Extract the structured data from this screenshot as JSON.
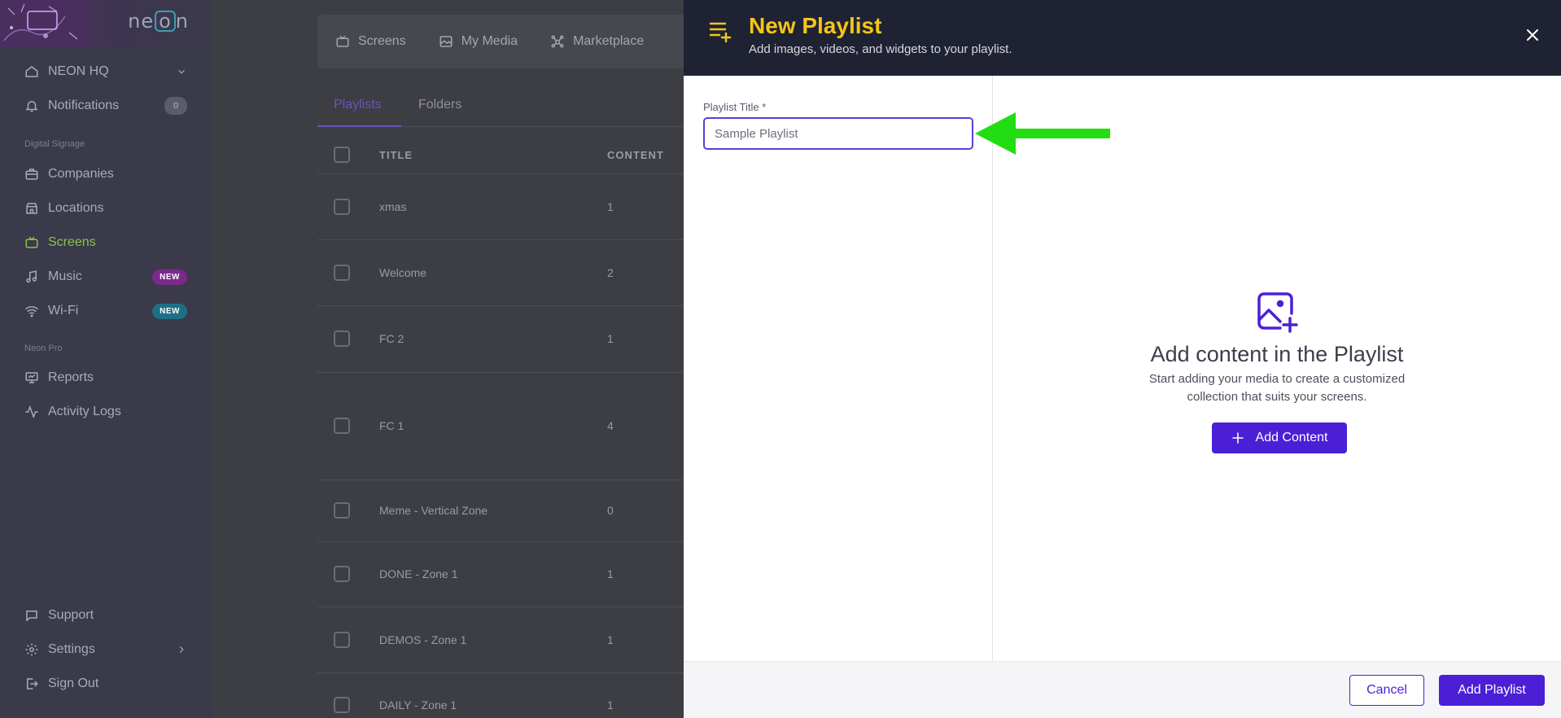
{
  "sidebar": {
    "logo_text": "neon",
    "org": {
      "label": "NEON HQ"
    },
    "notifications": {
      "label": "Notifications",
      "count": "0"
    },
    "section_digital": "Digital Signage",
    "items": [
      {
        "label": "Companies",
        "icon": "briefcase-icon"
      },
      {
        "label": "Locations",
        "icon": "store-icon"
      },
      {
        "label": "Screens",
        "icon": "tv-icon",
        "active": true
      },
      {
        "label": "Music",
        "icon": "music-icon",
        "badge": "NEW"
      },
      {
        "label": "Wi-Fi",
        "icon": "wifi-icon",
        "badge": "NEW"
      }
    ],
    "section_pro": "Neon Pro",
    "pro_items": [
      {
        "label": "Reports",
        "icon": "presentation-icon"
      },
      {
        "label": "Activity Logs",
        "icon": "activity-icon"
      }
    ],
    "bottom_items": [
      {
        "label": "Support",
        "icon": "chat-icon"
      },
      {
        "label": "Settings",
        "icon": "gear-icon"
      },
      {
        "label": "Sign Out",
        "icon": "sign-out-icon"
      }
    ]
  },
  "main": {
    "tabs": [
      "Screens",
      "My Media",
      "Marketplace"
    ],
    "subtabs": [
      "Playlists",
      "Folders"
    ],
    "columns": [
      "TITLE",
      "CONTENT"
    ],
    "rows": [
      {
        "title": "xmas",
        "content": "1"
      },
      {
        "title": "Welcome",
        "content": "2"
      },
      {
        "title": "FC 2",
        "content": "1"
      },
      {
        "title": "FC 1",
        "content": "4"
      },
      {
        "title": "Meme - Vertical Zone",
        "content": "0"
      },
      {
        "title": "DONE - Zone 1",
        "content": "1"
      },
      {
        "title": "DEMOS - Zone 1",
        "content": "1"
      },
      {
        "title": "DAILY - Zone 1",
        "content": "1"
      }
    ]
  },
  "modal": {
    "title": "New Playlist",
    "subtitle": "Add images, videos, and widgets to your playlist.",
    "field_label": "Playlist Title *",
    "field_value": "Sample Playlist",
    "empty_title": "Add content in the Playlist",
    "empty_desc": "Start adding your media to create a customized collection that suits your screens.",
    "add_content_label": "Add Content",
    "cancel_label": "Cancel",
    "submit_label": "Add Playlist"
  },
  "colors": {
    "accent": "#4b1fd6",
    "title_yellow": "#f5c518",
    "header_dark": "#1f2233",
    "arrow_green": "#22dd11",
    "active_green": "#8bc34a"
  }
}
